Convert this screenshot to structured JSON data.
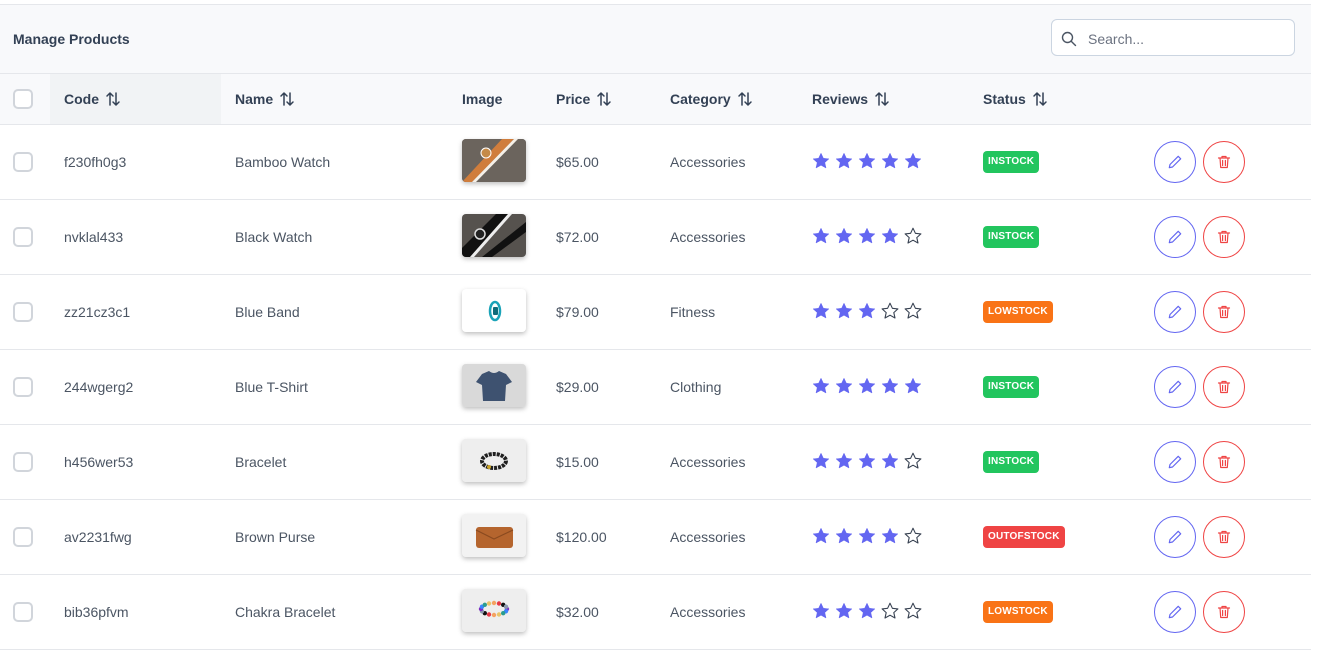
{
  "header": {
    "title": "Manage Products"
  },
  "search": {
    "placeholder": "Search..."
  },
  "columns": [
    {
      "key": "code",
      "label": "Code",
      "sortable": true
    },
    {
      "key": "name",
      "label": "Name",
      "sortable": true
    },
    {
      "key": "image",
      "label": "Image",
      "sortable": false
    },
    {
      "key": "price",
      "label": "Price",
      "sortable": true
    },
    {
      "key": "category",
      "label": "Category",
      "sortable": true
    },
    {
      "key": "reviews",
      "label": "Reviews",
      "sortable": true
    },
    {
      "key": "status",
      "label": "Status",
      "sortable": true
    }
  ],
  "colors": {
    "star": "#6366f1",
    "instock": "#22c55e",
    "lowstock": "#f97316",
    "outofstock": "#ef4444",
    "edit": "#6366f1",
    "delete": "#ef4444"
  },
  "products": [
    {
      "code": "f230fh0g3",
      "name": "Bamboo Watch",
      "image": "bamboo-watch-image",
      "price": "$65.00",
      "category": "Accessories",
      "rating": 5,
      "status": "INSTOCK"
    },
    {
      "code": "nvklal433",
      "name": "Black Watch",
      "image": "black-watch-image",
      "price": "$72.00",
      "category": "Accessories",
      "rating": 4,
      "status": "INSTOCK"
    },
    {
      "code": "zz21cz3c1",
      "name": "Blue Band",
      "image": "blue-band-image",
      "price": "$79.00",
      "category": "Fitness",
      "rating": 3,
      "status": "LOWSTOCK"
    },
    {
      "code": "244wgerg2",
      "name": "Blue T-Shirt",
      "image": "blue-tshirt-image",
      "price": "$29.00",
      "category": "Clothing",
      "rating": 5,
      "status": "INSTOCK"
    },
    {
      "code": "h456wer53",
      "name": "Bracelet",
      "image": "bracelet-image",
      "price": "$15.00",
      "category": "Accessories",
      "rating": 4,
      "status": "INSTOCK"
    },
    {
      "code": "av2231fwg",
      "name": "Brown Purse",
      "image": "brown-purse-image",
      "price": "$120.00",
      "category": "Accessories",
      "rating": 4,
      "status": "OUTOFSTOCK"
    },
    {
      "code": "bib36pfvm",
      "name": "Chakra Bracelet",
      "image": "chakra-bracelet-image",
      "price": "$32.00",
      "category": "Accessories",
      "rating": 3,
      "status": "LOWSTOCK"
    }
  ]
}
